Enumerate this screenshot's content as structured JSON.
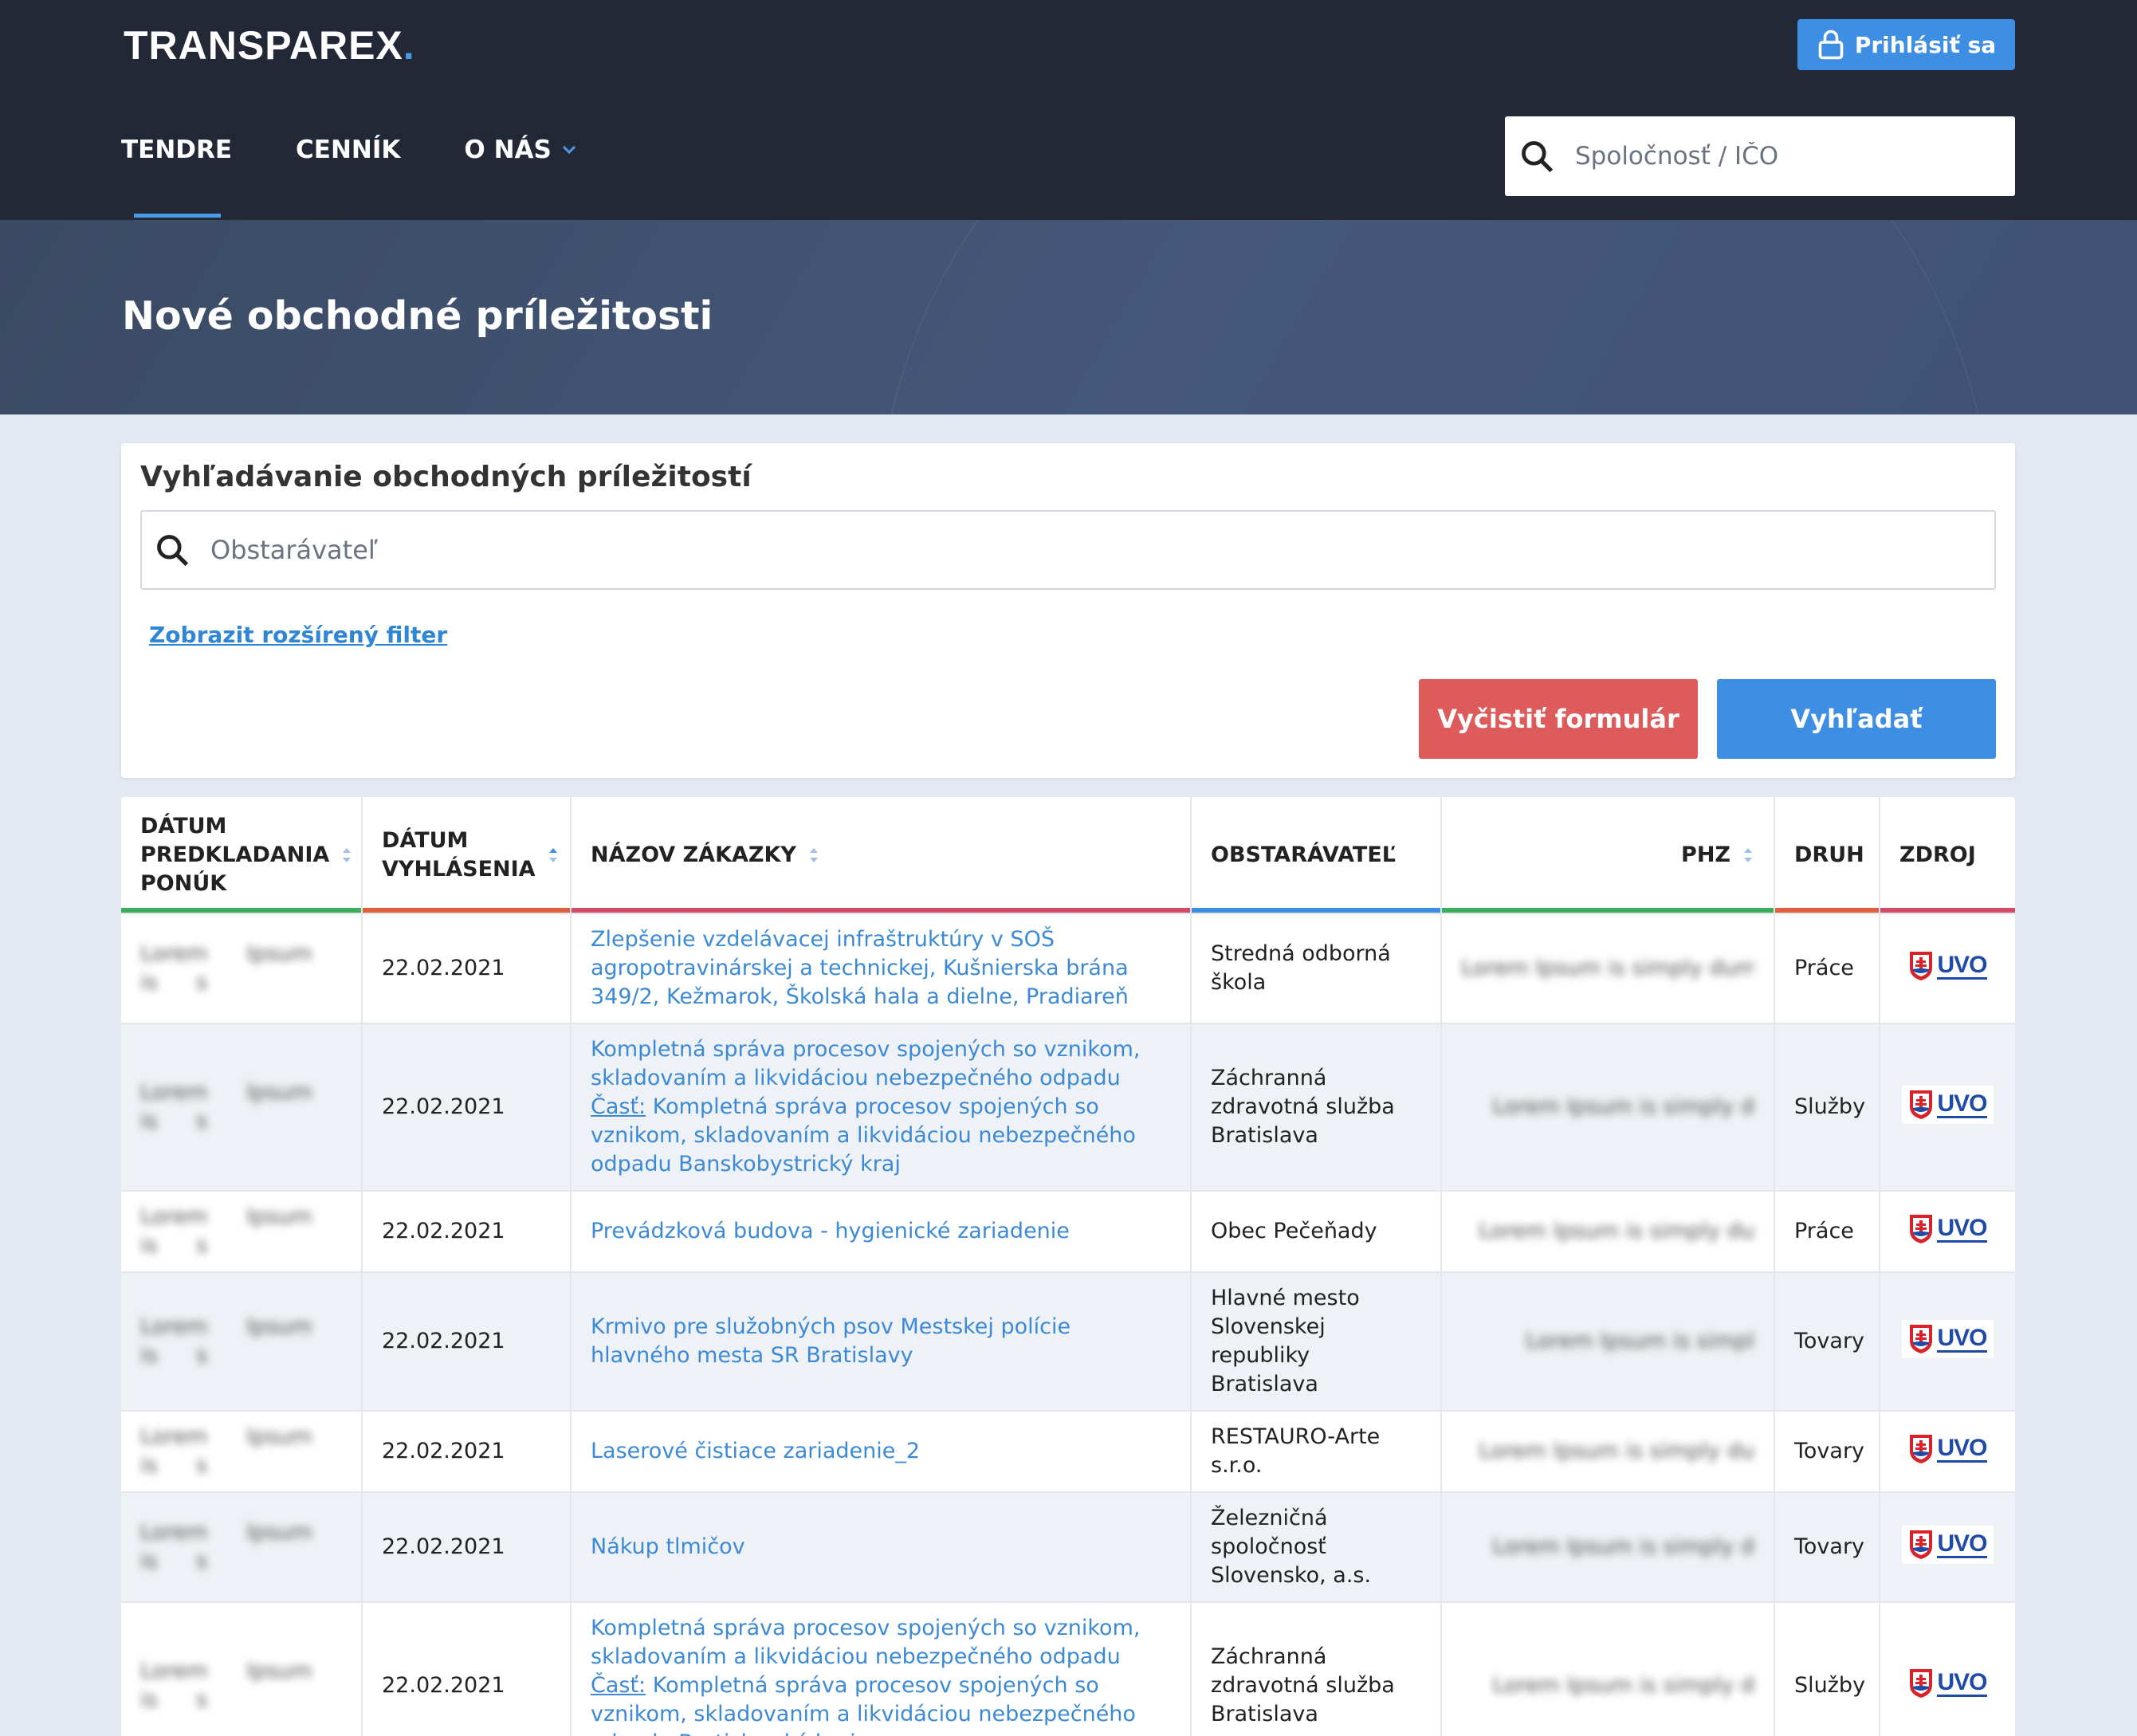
{
  "header": {
    "logo": "TRANSPAREX",
    "logo_dot": ".",
    "login_label": "Prihlásiť sa",
    "nav": [
      {
        "label": "TENDRE",
        "active": true
      },
      {
        "label": "CENNÍK",
        "active": false
      },
      {
        "label": "O NÁS",
        "active": false,
        "dropdown": true
      }
    ],
    "search_placeholder": "Spoločnosť / IČO"
  },
  "hero": {
    "title": "Nové obchodné príležitosti"
  },
  "search_card": {
    "title": "Vyhľadávanie obchodných príležitostí",
    "placeholder": "Obstarávateľ",
    "advanced_link": "Zobrazit rozšírený filter",
    "clear_button": "Vyčistiť formulár",
    "search_button": "Vyhľadať"
  },
  "table": {
    "columns": [
      {
        "label": "DÁTUM PREDKLADANIA PONÚK",
        "sortable": true,
        "bar": "#3dae5b"
      },
      {
        "label": "DÁTUM VYHLÁSENIA",
        "sortable": true,
        "bar": "#e0603b"
      },
      {
        "label": "NÁZOV ZÁKAZKY",
        "sortable": true,
        "bar": "#d64a6a"
      },
      {
        "label": "OBSTARÁVATEĽ",
        "sortable": false,
        "bar": "#3e8ee3"
      },
      {
        "label": "PHZ",
        "sortable": true,
        "bar": "#3dae5b"
      },
      {
        "label": "DRUH",
        "sortable": false,
        "bar": "#e0603b"
      },
      {
        "label": "ZDROJ",
        "sortable": false,
        "bar": "#d64a6a"
      }
    ],
    "cast_label": "Časť:",
    "source_label": "UVO",
    "rows": [
      {
        "deadline": "Lorem Ipsum is s",
        "published": "22.02.2021",
        "title": "Zlepšenie vzdelávacej infraštruktúry v SOŠ agropotravinárskej a technickej, Kušnierska brána 349/2, Kežmarok, Školská hala a dielne, Pradiareň",
        "part": "",
        "buyer": "Stredná odborná škola",
        "phz": "Lorem Ipsum is simply dumm",
        "kind": "Práce"
      },
      {
        "deadline": "Lorem Ipsum is s",
        "published": "22.02.2021",
        "title": "Kompletná správa procesov spojených so vznikom, skladovaním a likvidáciou nebezpečného odpadu",
        "part": "Kompletná správa procesov spojených so vznikom, skladovaním a likvidáciou nebezpečného odpadu Banskobystrický kraj",
        "buyer": "Záchranná zdravotná služba Bratislava",
        "phz": "Lorem Ipsum is simply d",
        "kind": "Služby"
      },
      {
        "deadline": "Lorem Ipsum is s",
        "published": "22.02.2021",
        "title": "Prevádzková budova - hygienické zariadenie",
        "part": "",
        "buyer": "Obec Pečeňady",
        "phz": "Lorem Ipsum is simply du",
        "kind": "Práce"
      },
      {
        "deadline": "Lorem Ipsum is s",
        "published": "22.02.2021",
        "title": "Krmivo pre služobných psov Mestskej polície hlavného mesta SR Bratislavy",
        "part": "",
        "buyer": "Hlavné mesto Slovenskej republiky Bratislava",
        "phz": "Lorem Ipsum is simpl",
        "kind": "Tovary"
      },
      {
        "deadline": "Lorem Ipsum is s",
        "published": "22.02.2021",
        "title": "Laserové čistiace zariadenie_2",
        "part": "",
        "buyer": "RESTAURO-Arte s.r.o.",
        "phz": "Lorem Ipsum is simply du",
        "kind": "Tovary"
      },
      {
        "deadline": "Lorem Ipsum is s",
        "published": "22.02.2021",
        "title": "Nákup tlmičov",
        "part": "",
        "buyer": "Železničná spoločnosť Slovensko, a.s.",
        "phz": "Lorem Ipsum is simply d",
        "kind": "Tovary"
      },
      {
        "deadline": "Lorem Ipsum is s",
        "published": "22.02.2021",
        "title": "Kompletná správa procesov spojených so vznikom, skladovaním a likvidáciou nebezpečného odpadu",
        "part": "Kompletná správa procesov spojených so vznikom, skladovaním a likvidáciou nebezpečného odpadu Bratislavský kraj",
        "buyer": "Záchranná zdravotná služba Bratislava",
        "phz": "Lorem Ipsum is simply d",
        "kind": "Služby"
      }
    ]
  },
  "colors": {
    "header_bg": "#222835",
    "accent": "#3e8ee3",
    "danger": "#dd5b5b",
    "link": "#3c8ad6"
  },
  "icons": [
    "lock-icon",
    "chevron-down-icon",
    "search-icon",
    "sort-icon",
    "uvo-logo-icon"
  ]
}
